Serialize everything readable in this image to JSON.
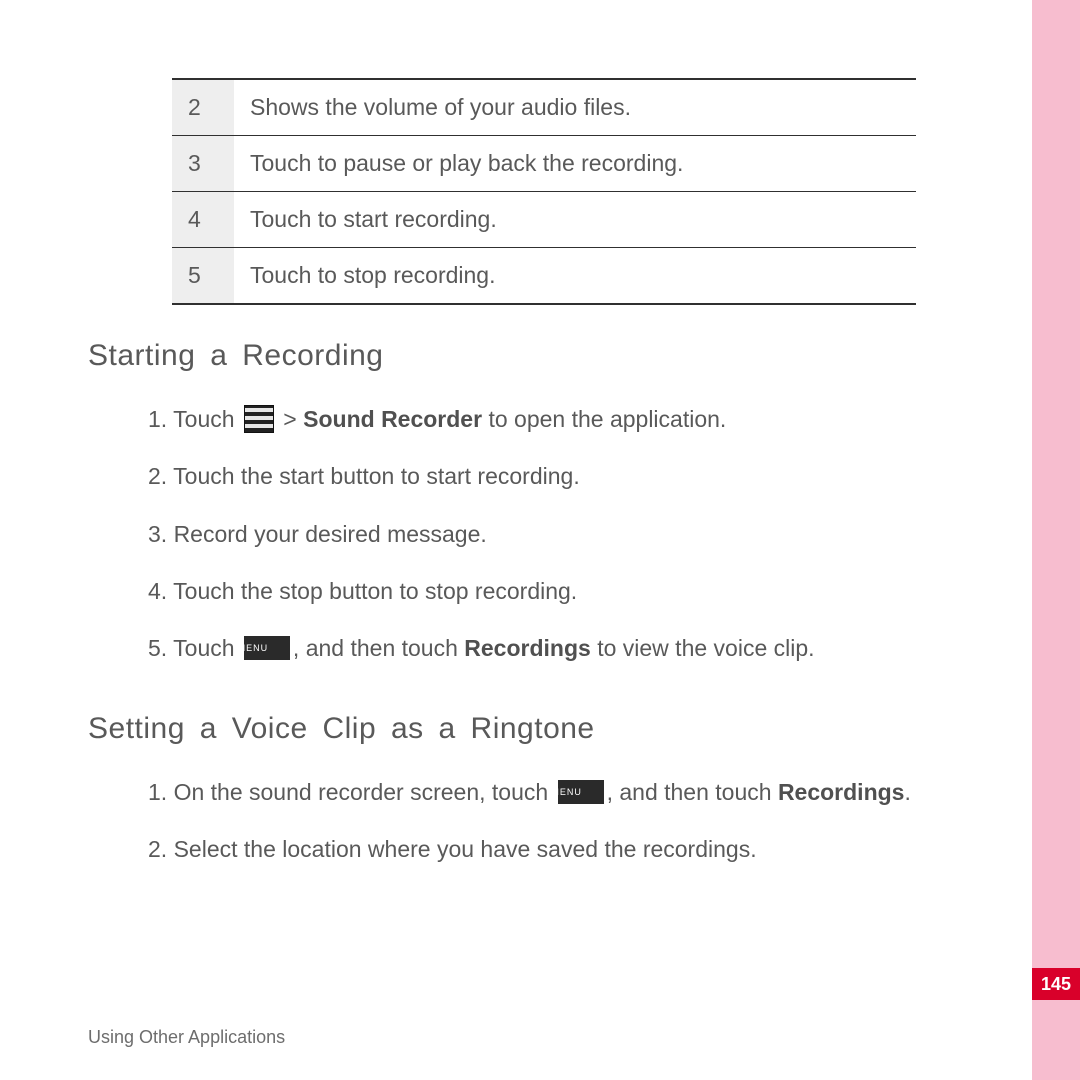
{
  "table": {
    "rows": [
      {
        "num": "2",
        "text": "Shows the volume of your audio files."
      },
      {
        "num": "3",
        "text": "Touch to pause or play back the recording."
      },
      {
        "num": "4",
        "text": "Touch to start recording."
      },
      {
        "num": "5",
        "text": "Touch to stop recording."
      }
    ]
  },
  "section1": {
    "title": "Starting a Recording",
    "steps": {
      "s1_prefix": "1. Touch ",
      "s1_gt": " > ",
      "s1_bold": "Sound Recorder",
      "s1_suffix": " to open the application.",
      "s2": "2. Touch the start button to start recording.",
      "s3": "3. Record your desired message.",
      "s4": "4. Touch the stop button to stop recording.",
      "s5_prefix": "5. Touch ",
      "s5_mid": ", and then touch ",
      "s5_bold": "Recordings",
      "s5_suffix": " to view the voice clip."
    }
  },
  "section2": {
    "title": "Setting a Voice Clip as a Ringtone",
    "steps": {
      "s1_prefix": "1. On the sound recorder screen, touch ",
      "s1_mid": ", and then touch ",
      "s1_bold": "Recordings",
      "s1_suffix": ".",
      "s2": "2. Select the location where you have saved the recordings."
    }
  },
  "footer": "Using Other Applications",
  "page_number": "145",
  "menu_label": "MENU"
}
